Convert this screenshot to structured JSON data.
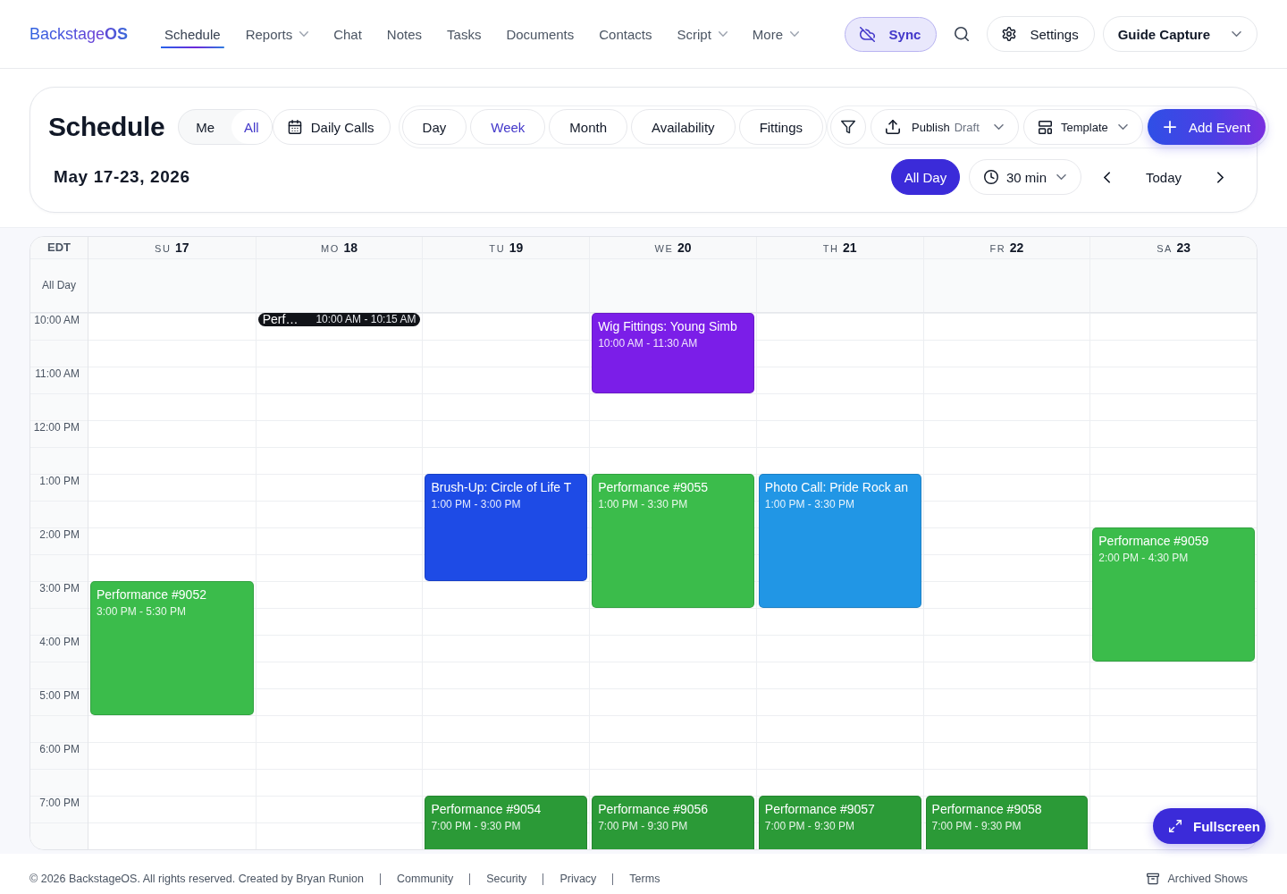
{
  "header": {
    "logo": "Backstage**OS**",
    "nav": [
      {
        "label": "Schedule",
        "selected": true,
        "dropdown": false
      },
      {
        "label": "Reports",
        "selected": false,
        "dropdown": true
      },
      {
        "label": "Chat",
        "selected": false,
        "dropdown": false
      },
      {
        "label": "Notes",
        "selected": false,
        "dropdown": false
      },
      {
        "label": "Tasks",
        "selected": false,
        "dropdown": false
      },
      {
        "label": "Documents",
        "selected": false,
        "dropdown": false
      },
      {
        "label": "Contacts",
        "selected": false,
        "dropdown": false
      },
      {
        "label": "Script",
        "selected": false,
        "dropdown": true
      },
      {
        "label": "More",
        "selected": false,
        "dropdown": true
      }
    ],
    "sync": {
      "label": "Sync"
    },
    "settings": {
      "label": "Settings"
    },
    "account": {
      "label": "Guide Capture"
    }
  },
  "toolbar": {
    "title": "Schedule",
    "scope": [
      {
        "label": "Me",
        "selected": false
      },
      {
        "label": "All",
        "selected": true
      }
    ],
    "daily_calls": {
      "label": "Daily Calls"
    },
    "views": [
      {
        "label": "Day",
        "selected": false
      },
      {
        "label": "Week",
        "selected": true
      },
      {
        "label": "Month",
        "selected": false
      },
      {
        "label": "Availability",
        "selected": false
      },
      {
        "label": "Fittings",
        "selected": false
      }
    ],
    "publish": {
      "label": "Publish",
      "status": "Draft"
    },
    "template": {
      "label": "Template"
    },
    "add_event": {
      "label": "Add Event"
    },
    "date_range": "May 17-23, 2026",
    "all_day": {
      "label": "All Day",
      "on": true
    },
    "interval": {
      "value": "30 min"
    },
    "today": {
      "label": "Today"
    }
  },
  "calendar": {
    "timezone": "EDT",
    "all_day_label": "All Day",
    "hours": [
      "10:00 AM",
      "11:00 AM",
      "12:00 PM",
      "1:00 PM",
      "2:00 PM",
      "3:00 PM",
      "4:00 PM",
      "5:00 PM",
      "6:00 PM",
      "7:00 PM"
    ],
    "days": [
      {
        "weekday": "SU",
        "date": "17",
        "events": [
          {
            "kind": "block",
            "title": "Performance #9052",
            "time": "3:00 PM - 5:30 PM",
            "color": "#3bbc4b"
          }
        ]
      },
      {
        "weekday": "MO",
        "date": "18",
        "events": [
          {
            "kind": "pill",
            "title": "Perf…",
            "time": "10:00 AM - 10:15 AM",
            "color": "#111318"
          }
        ]
      },
      {
        "weekday": "TU",
        "date": "19",
        "events": [
          {
            "kind": "block",
            "title": "Brush-Up: Circle of Life T",
            "time": "1:00 PM - 3:00 PM",
            "color": "#1e4be6"
          },
          {
            "kind": "block",
            "title": "Performance #9054",
            "time": "7:00 PM - 9:30 PM",
            "color": "#2b9a37"
          }
        ]
      },
      {
        "weekday": "WE",
        "date": "20",
        "events": [
          {
            "kind": "block",
            "title": "Wig Fittings: Young Simb",
            "time": "10:00 AM - 11:30 AM",
            "color": "#7b1ee8"
          },
          {
            "kind": "block",
            "title": "Performance #9055",
            "time": "1:00 PM - 3:30 PM",
            "color": "#3bbc4b"
          },
          {
            "kind": "block",
            "title": "Performance #9056",
            "time": "7:00 PM - 9:30 PM",
            "color": "#2b9a37"
          }
        ]
      },
      {
        "weekday": "TH",
        "date": "21",
        "events": [
          {
            "kind": "block",
            "title": "Photo Call: Pride Rock an",
            "time": "1:00 PM - 3:30 PM",
            "color": "#2196e5"
          },
          {
            "kind": "block",
            "title": "Performance #9057",
            "time": "7:00 PM - 9:30 PM",
            "color": "#2b9a37"
          }
        ]
      },
      {
        "weekday": "FR",
        "date": "22",
        "events": [
          {
            "kind": "block",
            "title": "Performance #9058",
            "time": "7:00 PM - 9:30 PM",
            "color": "#2b9a37"
          }
        ]
      },
      {
        "weekday": "SA",
        "date": "23",
        "events": [
          {
            "kind": "block",
            "title": "Performance #9059",
            "time": "2:00 PM - 4:30 PM",
            "color": "#3bbc4b"
          }
        ]
      }
    ]
  },
  "fullscreen": {
    "label": "Fullscreen"
  },
  "footer": {
    "copyright": "© 2026 BackstageOS. All rights reserved. Created by Bryan Runion",
    "links": [
      "Community",
      "Security",
      "Privacy",
      "Terms"
    ],
    "archived": "Archived Shows"
  }
}
